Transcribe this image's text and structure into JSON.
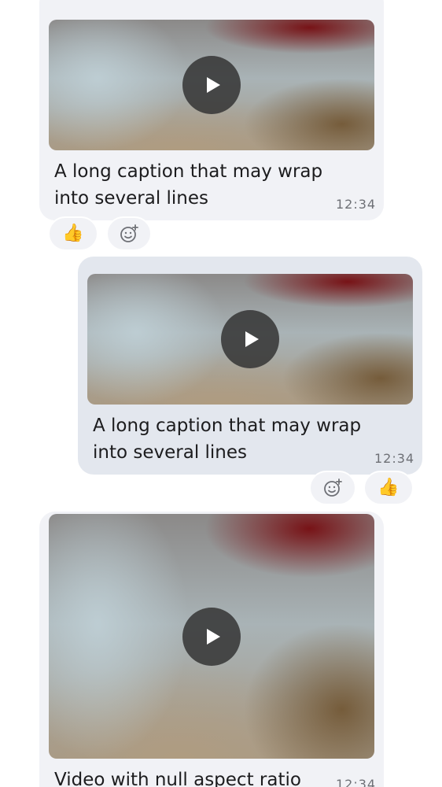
{
  "messages": [
    {
      "direction": "incoming",
      "caption": "A long caption that may wrap into several lines",
      "time": "12:34",
      "reactions": [
        {
          "emoji": "👍",
          "icon": "thumbs-up"
        },
        {
          "icon": "add-reaction-icon"
        }
      ]
    },
    {
      "direction": "outgoing",
      "caption": "A long caption that may wrap into several lines",
      "time": "12:34",
      "reactions": [
        {
          "icon": "add-reaction-icon"
        },
        {
          "emoji": "👍",
          "icon": "thumbs-up"
        }
      ]
    },
    {
      "direction": "incoming",
      "caption": "Video with null aspect ratio",
      "time": "12:34"
    }
  ],
  "colors": {
    "incoming_bubble": "#f1f2f6",
    "outgoing_bubble": "#e3e7ee",
    "caption_text": "#1c1c1e",
    "time_text": "#6e7076"
  }
}
